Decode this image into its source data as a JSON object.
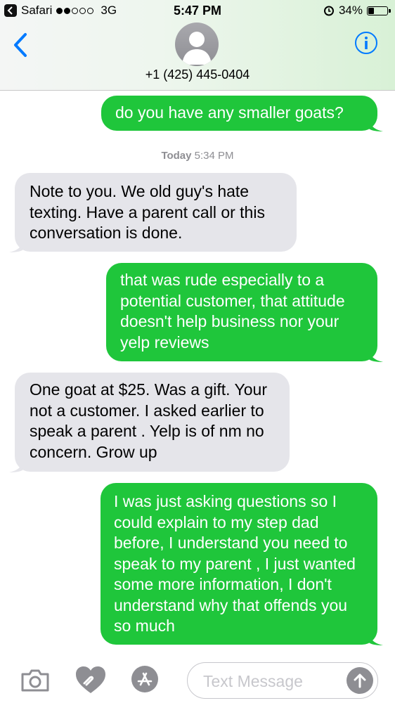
{
  "status_bar": {
    "back_app": "Safari",
    "carrier": "3G",
    "time": "5:47 PM",
    "battery": "34%",
    "battery_level": 0.34,
    "signal_bars": 2
  },
  "header": {
    "contact_number": "+1 (425) 445-0404"
  },
  "messages": [
    {
      "direction": "sent",
      "text": "do you have any smaller goats?"
    },
    {
      "direction": "received",
      "text": "Note to you.  We old guy's hate texting.  Have a parent call or this conversation is done."
    },
    {
      "direction": "sent",
      "text": "that was rude especially to a potential customer, that attitude doesn't help business nor your yelp reviews"
    },
    {
      "direction": "received",
      "text": "One goat at $25. Was a gift. Your not a customer. I  asked earlier to speak a parent . Yelp is of nm no concern.  Grow up"
    },
    {
      "direction": "sent",
      "text": "I was just asking questions so I could explain to my step dad before, I understand you need to speak to my parent , I just wanted some more information, I don't understand why that offends you so much"
    }
  ],
  "timestamp": {
    "day": "Today",
    "time": "5:34 PM"
  },
  "compose": {
    "placeholder": "Text Message"
  },
  "colors": {
    "sent_bubble": "#1fc63b",
    "received_bubble": "#e5e5ea",
    "accent_blue": "#007aff"
  },
  "icons": [
    "back-chevron-icon",
    "contact-avatar-icon",
    "info-icon",
    "camera-icon",
    "digital-touch-icon",
    "app-store-icon",
    "send-arrow-icon"
  ]
}
